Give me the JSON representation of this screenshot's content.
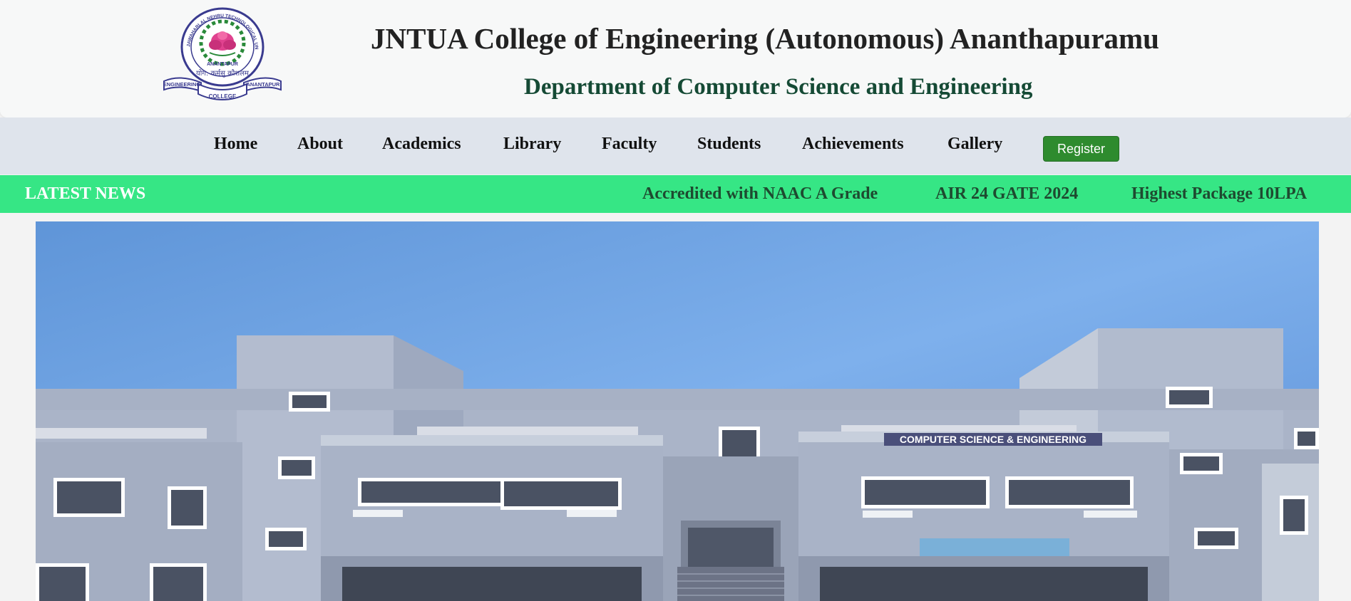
{
  "header": {
    "college_title": "JNTUA College of Engineering (Autonomous) Ananthapuramu",
    "department_title": "Department of Computer Science and Engineering",
    "logo": {
      "arc_text": "JAWAHARLAL NEHRU TECHNOLOGICAL UNIVERSITY",
      "inner_text": "ANANTAPUR",
      "motto": "योग: कर्मसु कौशलम्",
      "ribbon_left": "ENGINEERING",
      "ribbon_center": "COLLEGE",
      "ribbon_right": "ANANTAPUR",
      "icon": "lotus-gear-emblem"
    }
  },
  "nav": {
    "items": [
      {
        "label": "Home"
      },
      {
        "label": "About"
      },
      {
        "label": "Academics"
      },
      {
        "label": "Library"
      },
      {
        "label": "Faculty"
      },
      {
        "label": "Students"
      },
      {
        "label": "Achievements"
      },
      {
        "label": "Gallery"
      }
    ],
    "register_label": "Register"
  },
  "news": {
    "label": "LATEST NEWS",
    "items": [
      {
        "text": "Accredited with NAAC A Grade"
      },
      {
        "text": "AIR 24 GATE 2024"
      },
      {
        "text": "Highest Package 10LPA"
      }
    ]
  },
  "hero": {
    "building_sign": "COMPUTER SCIENCE & ENGINEERING"
  },
  "colors": {
    "nav_bg": "#dfe4ec",
    "news_bg": "#36e685",
    "register_bg": "#2e8b2e",
    "dept_title": "#154a35"
  }
}
